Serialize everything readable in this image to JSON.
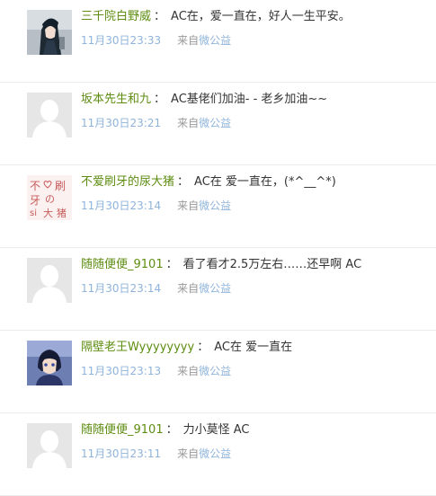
{
  "comments": [
    {
      "user": "三千院白野威",
      "colon": "：",
      "text": "AC在，爱一直在，好人一生平安。",
      "time": "11月30日23:33",
      "from": "来自",
      "source": "微公益",
      "avatar": "anime-girl-avatar"
    },
    {
      "user": "坂本先生和九",
      "colon": "：",
      "text": "AC基佬们加油- - 老乡加油~~",
      "time": "11月30日23:21",
      "from": "来自",
      "source": "微公益",
      "avatar": "default-avatar"
    },
    {
      "user": "不爱刷牙的尿大猪",
      "colon": "：",
      "text": "AC在 爱一直在，(*^__^*)",
      "time": "11月30日23:14",
      "from": "来自",
      "source": "微公益",
      "avatar": "handwriting-avatar",
      "avatar_text": [
        "不",
        "刷",
        "牙",
        "の",
        "si",
        "大",
        "猪"
      ]
    },
    {
      "user": "随随便便_9101",
      "colon": "：",
      "text": "看了看才2.5万左右……还早啊 AC",
      "time": "11月30日23:14",
      "from": "来自",
      "source": "微公益",
      "avatar": "default-avatar"
    },
    {
      "user": "隔壁老王Wyyyyyyyy",
      "colon": "：",
      "text": "AC在 爱一直在",
      "time": "11月30日23:13",
      "from": "来自",
      "source": "微公益",
      "avatar": "anime-boy-avatar"
    },
    {
      "user": "随随便便_9101",
      "colon": "：",
      "text": "力小莫怪 AC",
      "time": "11月30日23:11",
      "from": "来自",
      "source": "微公益",
      "avatar": "default-avatar"
    }
  ],
  "colors": {
    "username": "#5e8d12",
    "link": "#8fb4dc",
    "muted": "#999999",
    "text": "#333333"
  }
}
